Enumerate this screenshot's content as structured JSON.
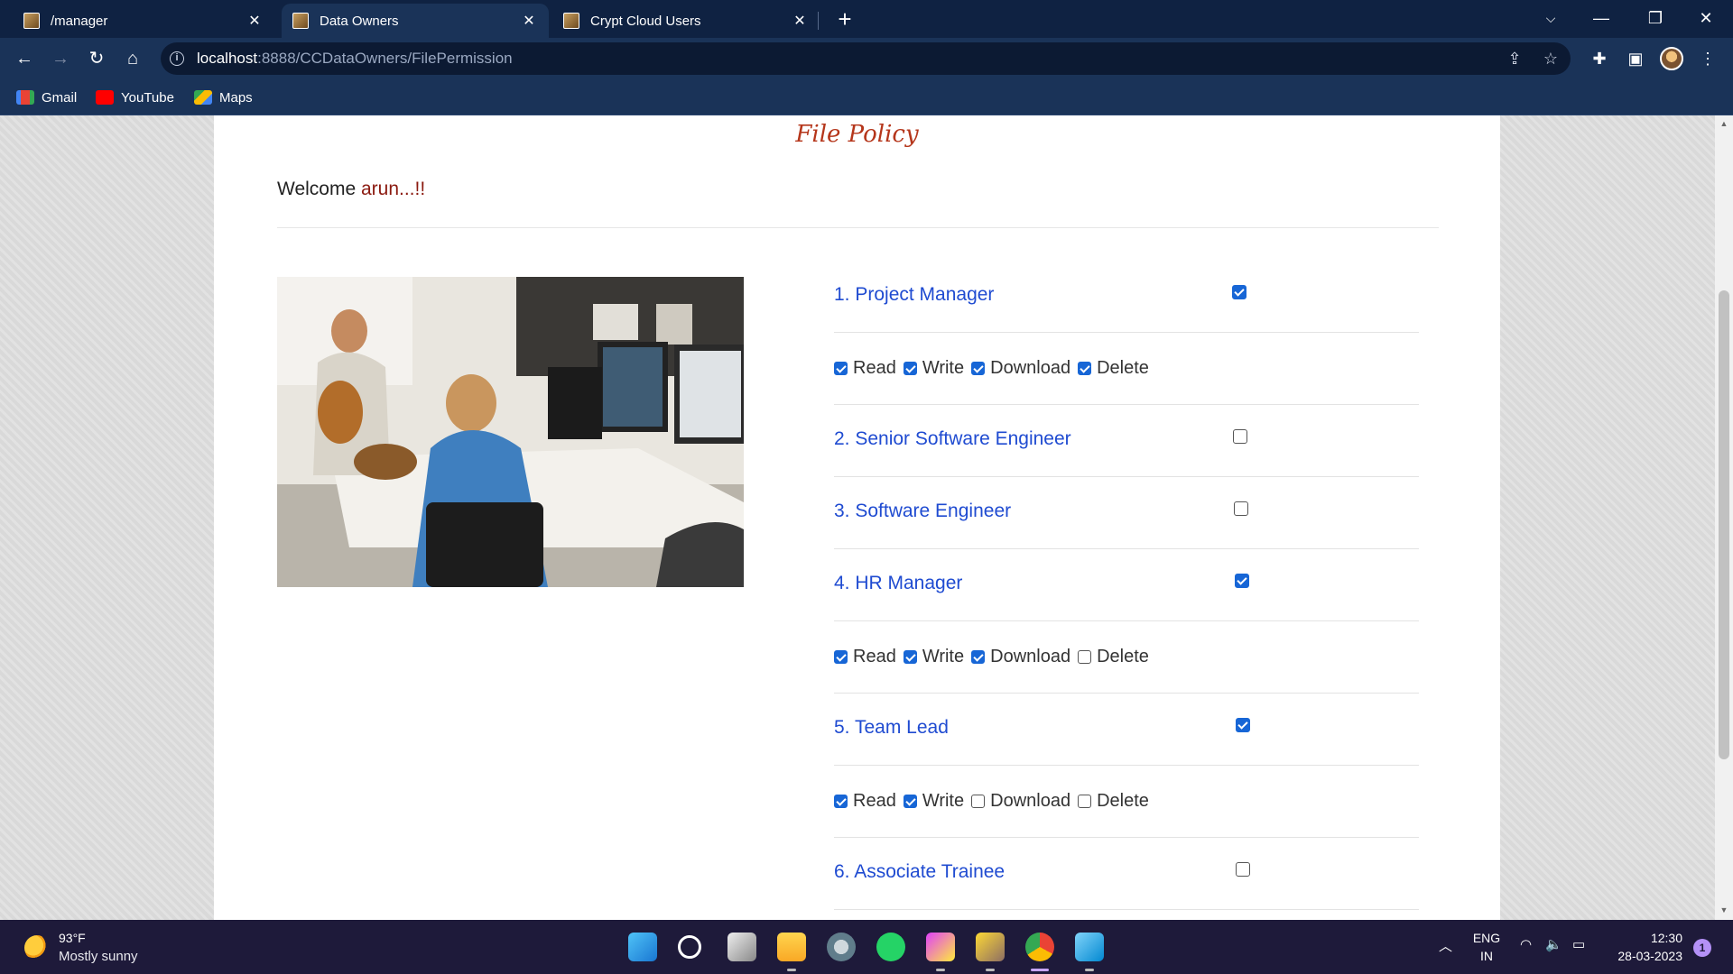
{
  "browser": {
    "tabs": [
      {
        "title": "/manager",
        "active": false
      },
      {
        "title": "Data Owners",
        "active": true
      },
      {
        "title": "Crypt Cloud Users",
        "active": false
      }
    ],
    "url_host": "localhost",
    "url_rest": ":8888/CCDataOwners/FilePermission",
    "bookmarks": [
      "Gmail",
      "YouTube",
      "Maps"
    ]
  },
  "page": {
    "title": "File Policy",
    "welcome_prefix": "Welcome",
    "username": "arun...!!",
    "roles": [
      {
        "label": "1. Project Manager",
        "checked": true,
        "perms": [
          {
            "label": "Read",
            "checked": true
          },
          {
            "label": "Write",
            "checked": true
          },
          {
            "label": "Download",
            "checked": true
          },
          {
            "label": "Delete",
            "checked": true
          }
        ]
      },
      {
        "label": "2. Senior Software Engineer",
        "checked": false,
        "perms": []
      },
      {
        "label": "3. Software Engineer",
        "checked": false,
        "perms": []
      },
      {
        "label": "4. HR Manager",
        "checked": true,
        "perms": [
          {
            "label": "Read",
            "checked": true
          },
          {
            "label": "Write",
            "checked": true
          },
          {
            "label": "Download",
            "checked": true
          },
          {
            "label": "Delete",
            "checked": false
          }
        ]
      },
      {
        "label": "5. Team Lead",
        "checked": true,
        "perms": [
          {
            "label": "Read",
            "checked": true
          },
          {
            "label": "Write",
            "checked": true
          },
          {
            "label": "Download",
            "checked": false
          },
          {
            "label": "Delete",
            "checked": false
          }
        ]
      },
      {
        "label": "6. Associate Trainee",
        "checked": false,
        "perms": []
      }
    ]
  },
  "taskbar": {
    "temperature": "93°F",
    "weather": "Mostly sunny",
    "lang_line1": "ENG",
    "lang_line2": "IN",
    "time": "12:30",
    "date": "28-03-2023",
    "notifications": "1"
  },
  "colors": {
    "title": "#b5361b",
    "role_link": "#1f4bd1",
    "checkbox_on": "#1766d6",
    "tab_bar": "#0f2242",
    "toolbar": "#1a3358"
  }
}
